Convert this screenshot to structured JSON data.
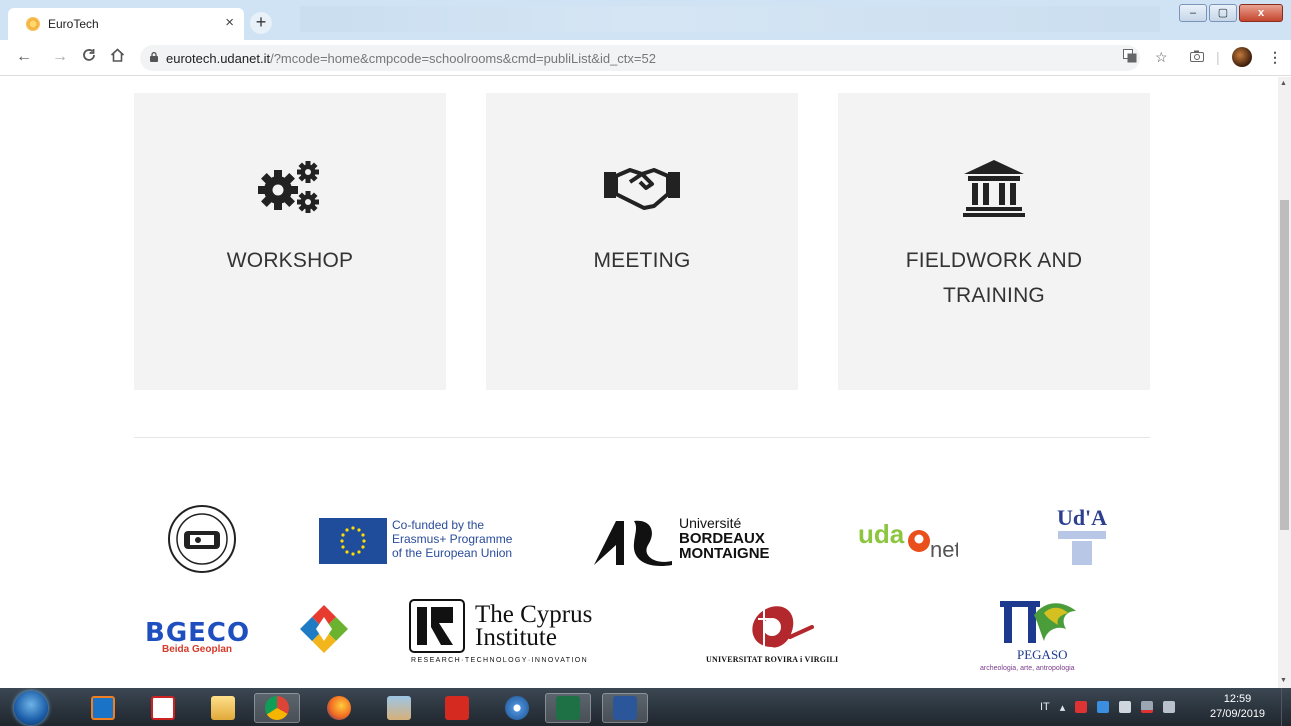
{
  "browser": {
    "tab_title": "EuroTech",
    "tab_close": "×",
    "new_tab": "+",
    "url_domain": "eurotech.udanet.it",
    "url_path": "/?mcode=home&cmpcode=schoolrooms&cmd=publiList&id_ctx=52",
    "window_buttons": {
      "minimize": "–",
      "maximize": "▢",
      "close": "x"
    }
  },
  "cards": [
    {
      "icon": "gears-icon",
      "label": "WORKSHOP"
    },
    {
      "icon": "handshake-icon",
      "label": "MEETING"
    },
    {
      "icon": "institution-icon",
      "label": "FIELDWORK AND TRAINING"
    }
  ],
  "partners": {
    "eu": {
      "line1": "Co-funded by the",
      "line2": "Erasmus+ Programme",
      "line3": "of the European Union"
    },
    "bordeaux": {
      "line1": "Université",
      "line2": "BORDEAUX",
      "line3": "MONTAIGNE"
    },
    "udanet": {
      "prefix": "uda",
      "suffix": "net"
    },
    "uda": {
      "name": "Ud'A"
    },
    "bgeco": {
      "name": "BGECO",
      "sub": "Beida Geoplan"
    },
    "cyprus": {
      "line1": "The Cyprus",
      "line2": "Institute",
      "tagline": "RESEARCH·TECHNOLOGY·INNOVATION"
    },
    "urv": {
      "name": "UNIVERSITAT ROVIRA i VIRGILI"
    },
    "pegaso": {
      "name": "PEGASO",
      "sub": "archeologia, arte, antropologia"
    }
  },
  "taskbar": {
    "language": "IT",
    "time": "12:59",
    "date": "27/09/2019"
  },
  "colors": {
    "card_bg": "#f3f3f3",
    "card_text": "#333333",
    "taskbar": "#263039"
  }
}
